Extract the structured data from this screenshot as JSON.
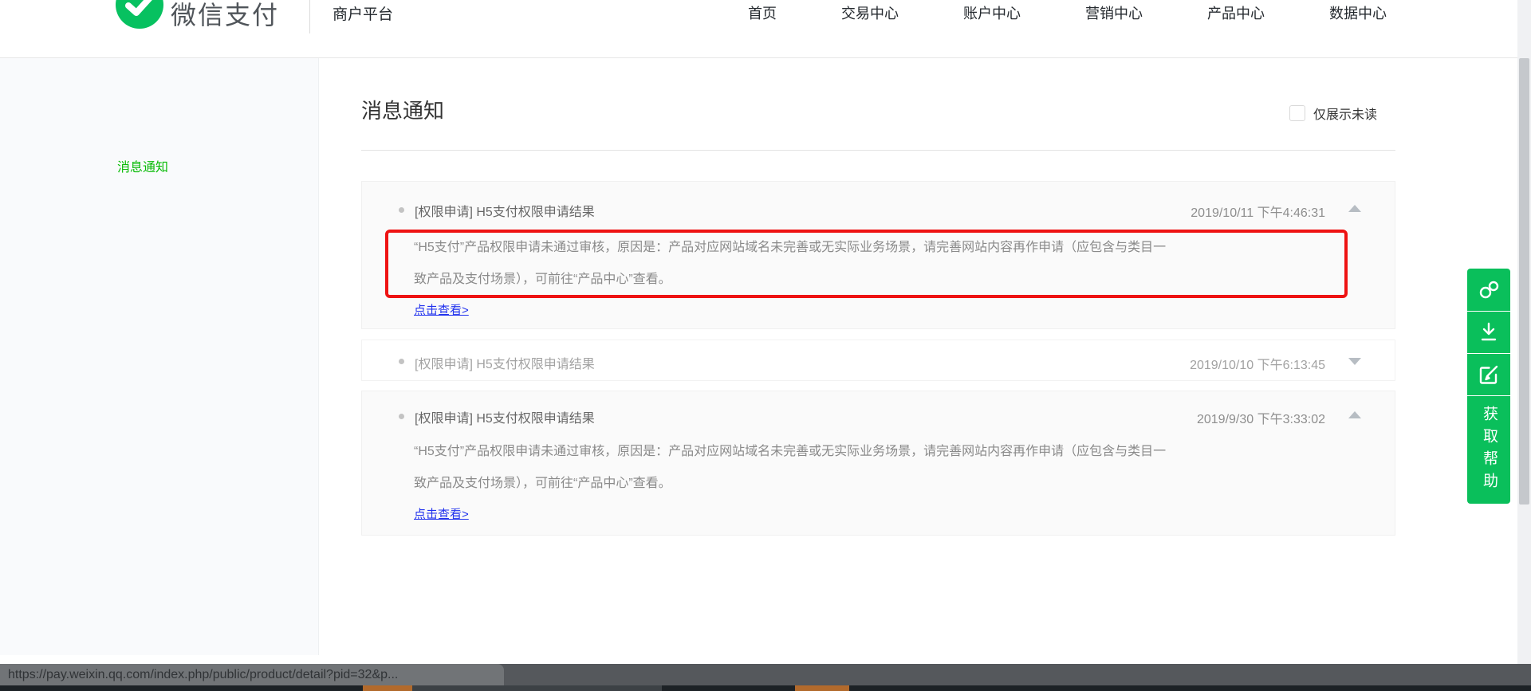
{
  "header": {
    "logo_text": "微信支付",
    "portal_label": "商户平台",
    "nav": [
      {
        "label": "首页"
      },
      {
        "label": "交易中心"
      },
      {
        "label": "账户中心"
      },
      {
        "label": "营销中心"
      },
      {
        "label": "产品中心"
      },
      {
        "label": "数据中心"
      }
    ]
  },
  "sidebar": {
    "items": [
      {
        "label": "消息通知",
        "active": true
      }
    ]
  },
  "main": {
    "title": "消息通知",
    "filter_label": "仅展示未读",
    "filter_checked": false,
    "messages": [
      {
        "title": "[权限申请] H5支付权限申请结果",
        "time": "2019/10/11 下午4:46:31",
        "expanded": true,
        "unread": true,
        "body_line1": "“H5支付”产品权限申请未通过审核，原因是：产品对应网站域名未完善或无实际业务场景，请完善网站内容再作申请（应包含与类目一",
        "body_line2": "致产品及支付场景），可前往“产品中心”查看。",
        "link_label": "点击查看>",
        "highlighted_by_red_box": true
      },
      {
        "title": "[权限申请] H5支付权限申请结果",
        "time": "2019/10/10 下午6:13:45",
        "expanded": false,
        "unread": false
      },
      {
        "title": "[权限申请] H5支付权限申请结果",
        "time": "2019/9/30 下午3:33:02",
        "expanded": true,
        "unread": true,
        "body_line1": "“H5支付”产品权限申请未通过审核，原因是：产品对应网站域名未完善或无实际业务场景，请完善网站内容再作申请（应包含与类目一",
        "body_line2": "致产品及支付场景），可前往“产品中心”查看。",
        "link_label": "点击查看>",
        "highlighted_by_red_box": false
      }
    ]
  },
  "float_toolbar": {
    "icons": [
      "link-icon",
      "download-icon",
      "feedback-icon"
    ],
    "help_label": "获取帮助"
  },
  "statusbar": {
    "url": "https://pay.weixin.qq.com/index.php/public/product/detail?pid=32&p..."
  },
  "colors": {
    "brand_green": "#0abf5b",
    "sidebar_green": "#09bb07",
    "highlight_red": "#ee1313",
    "link_blue": "#2233ee"
  }
}
